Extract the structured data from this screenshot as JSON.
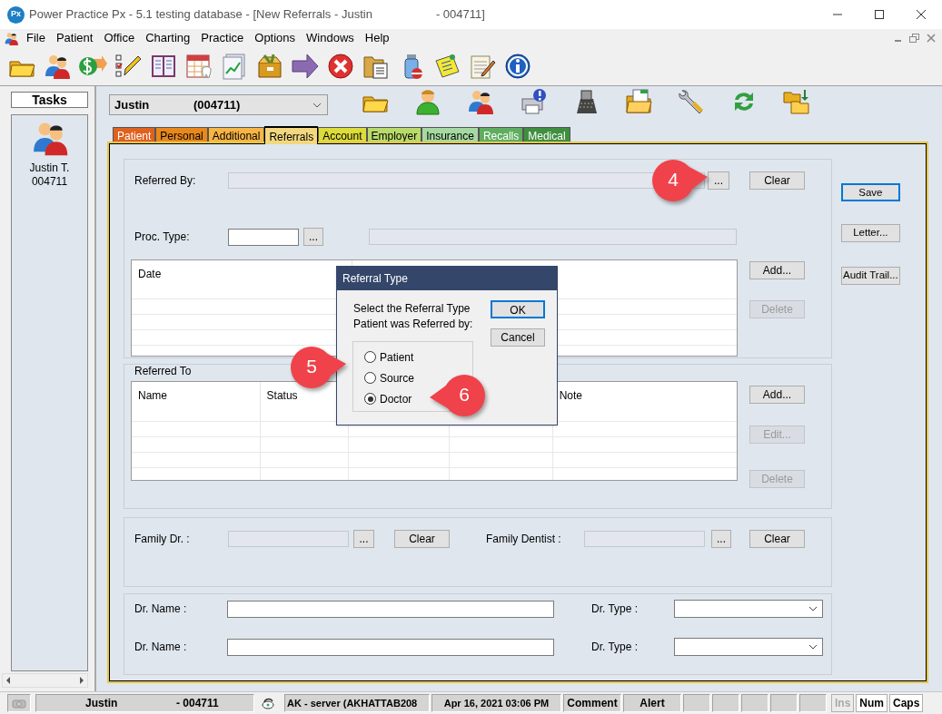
{
  "window": {
    "app_badge": "Px",
    "title": "Power Practice Px - 5.1 testing database - [New Referrals - Justin",
    "title_suffix": "- 004711]"
  },
  "menu": [
    "File",
    "Patient",
    "Office",
    "Charting",
    "Practice",
    "Options",
    "Windows",
    "Help"
  ],
  "tasks": {
    "title": "Tasks",
    "items": [
      {
        "name": "Justin T.",
        "id": "004711"
      }
    ]
  },
  "patient_selector": {
    "name": "Justin",
    "id": "(004711)"
  },
  "tabs": [
    {
      "label": "Patient",
      "selected": false,
      "color": "#e0601e"
    },
    {
      "label": "Personal",
      "selected": false,
      "color": "#e8881c"
    },
    {
      "label": "Additional",
      "selected": false,
      "color": "#f6b544"
    },
    {
      "label": "Referrals",
      "selected": true,
      "color": "#f2d77e"
    },
    {
      "label": "Account",
      "selected": false,
      "color": "#dcdc3a"
    },
    {
      "label": "Employer",
      "selected": false,
      "color": "#b9da6a"
    },
    {
      "label": "Insurance",
      "selected": false,
      "color": "#a6d9a2"
    },
    {
      "label": "Recalls",
      "selected": false,
      "color": "#5fae5f"
    },
    {
      "label": "Medical",
      "selected": false,
      "color": "#3f8f3f"
    }
  ],
  "referred_by": {
    "label": "Referred By:",
    "browse": "...",
    "clear": "Clear"
  },
  "proc_type": {
    "label": "Proc. Type:",
    "browse": "..."
  },
  "referral_table": {
    "columns": [
      "Date"
    ],
    "buttons": [
      {
        "label": "Add...",
        "disabled": false
      },
      {
        "label": "Delete",
        "disabled": true
      }
    ]
  },
  "referred_to": {
    "legend": "Referred To",
    "columns": [
      "Name",
      "Status",
      "Note"
    ],
    "buttons": [
      {
        "label": "Add...",
        "disabled": false
      },
      {
        "label": "Edit...",
        "disabled": true
      },
      {
        "label": "Delete",
        "disabled": true
      }
    ]
  },
  "family": [
    {
      "label": "Family Dr. :",
      "browse": "...",
      "clear": "Clear"
    },
    {
      "label": "Family Dentist :",
      "browse": "...",
      "clear": "Clear"
    }
  ],
  "doctors": [
    {
      "name_label": "Dr. Name :",
      "type_label": "Dr. Type :"
    },
    {
      "name_label": "Dr. Name :",
      "type_label": "Dr. Type :"
    }
  ],
  "actions": [
    {
      "label": "Save",
      "focused": true
    },
    {
      "label": "Letter...",
      "focused": false
    },
    {
      "label": "Audit Trail...",
      "focused": false
    }
  ],
  "dialog": {
    "title": "Referral Type",
    "prompt": [
      "Select the Referral Type",
      "Patient was Referred by:"
    ],
    "buttons": [
      {
        "label": "OK",
        "focused": true
      },
      {
        "label": "Cancel",
        "focused": false
      }
    ],
    "options": [
      {
        "label": "Patient",
        "selected": false
      },
      {
        "label": "Source",
        "selected": false
      },
      {
        "label": "Doctor",
        "selected": true
      }
    ]
  },
  "callouts": [
    {
      "number": "4"
    },
    {
      "number": "5"
    },
    {
      "number": "6"
    }
  ],
  "status_bar": {
    "user": "Justin",
    "patient_id": "- 004711",
    "server": "AK - server (AKHATTAB208",
    "datetime": "Apr 16, 2021 03:06 PM",
    "panels": [
      "Comment",
      "Alert"
    ],
    "keys": [
      {
        "label": "Ins",
        "on": false
      },
      {
        "label": "Num",
        "on": true
      },
      {
        "label": "Caps",
        "on": true
      }
    ]
  }
}
